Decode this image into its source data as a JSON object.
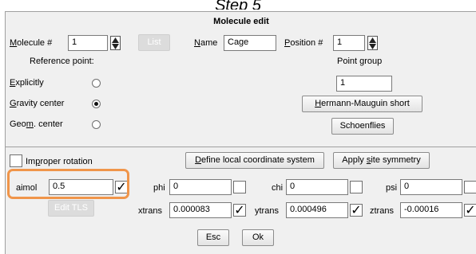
{
  "step_title": "Step 5",
  "window": {
    "title": "Molecule edit"
  },
  "molecule": {
    "label": "Molecule #",
    "value": "1",
    "list_button": "List",
    "name_label": "Name",
    "name_value": "Cage",
    "position_label": "Position #",
    "position_value": "1"
  },
  "reference_point": {
    "title": "Reference point:",
    "options": [
      {
        "label": "Explicitly",
        "selected": false
      },
      {
        "label": "Gravity center",
        "selected": true
      },
      {
        "label": "Geom. center",
        "selected": false
      }
    ]
  },
  "point_group": {
    "title": "Point group",
    "value": "1",
    "hm_button": "Hermann-Mauguin short",
    "schoenflies_button": "Schoenflies"
  },
  "improper_rotation": {
    "label": "Improper rotation",
    "checked": false
  },
  "buttons": {
    "define_lcs": "Define local coordinate system",
    "apply_site_symmetry": "Apply site symmetry",
    "edit_tls": "Edit TLS",
    "esc": "Esc",
    "ok": "Ok"
  },
  "params": {
    "aimol": {
      "label": "aimol",
      "value": "0.5",
      "checked": true
    },
    "phi": {
      "label": "phi",
      "value": "0",
      "checked": false
    },
    "chi": {
      "label": "chi",
      "value": "0",
      "checked": false
    },
    "psi": {
      "label": "psi",
      "value": "0",
      "checked": false
    },
    "xtrans": {
      "label": "xtrans",
      "value": "0.000083",
      "checked": true
    },
    "ytrans": {
      "label": "ytrans",
      "value": "0.000496",
      "checked": true
    },
    "ztrans": {
      "label": "ztrans",
      "value": "-0.00016",
      "checked": true
    }
  },
  "colors": {
    "highlight": "#f0954a",
    "window_bg": "#f0f0f0"
  },
  "icons": {
    "spinner": "up-down-spinner-icon",
    "check": "checkmark-icon"
  },
  "check_glyph": "✓"
}
